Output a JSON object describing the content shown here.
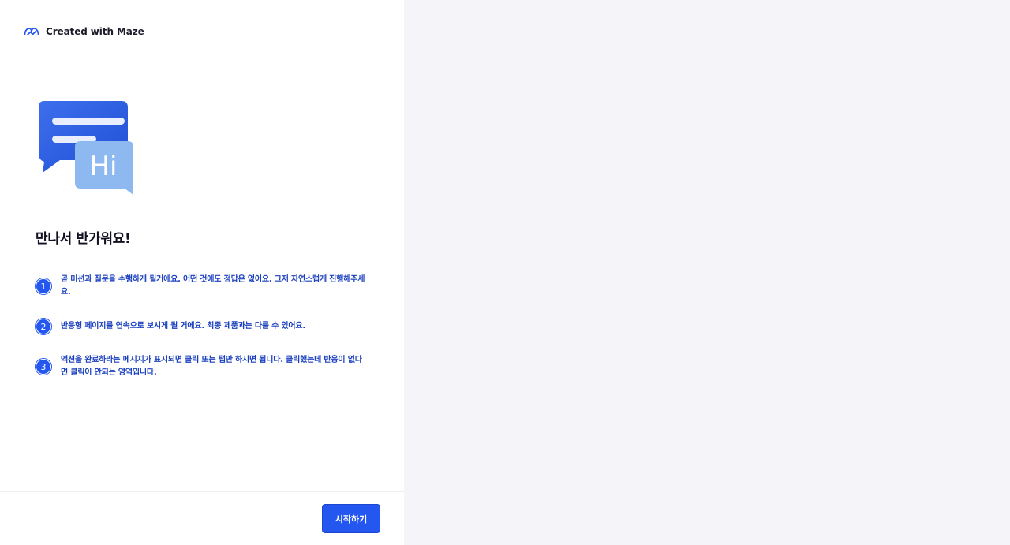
{
  "brand": {
    "label": "Created with Maze",
    "icon": "maze-logo-icon"
  },
  "welcome": {
    "title": "만나서 반가워요!",
    "illustration_text": "Hi"
  },
  "steps": [
    {
      "number": "1",
      "text": "곧 미션과 질문을 수행하게 될거에요. 어떤 것에도 정답은 없어요. 그저 자연스럽게 진행해주세요."
    },
    {
      "number": "2",
      "text": "반응형 페이지를 연속으로 보시게 될 거에요. 최종 제품과는 다를 수 있어요."
    },
    {
      "number": "3",
      "text": "액션을 완료하라는 메시지가 표시되면 클릭 또는 탭만 하시면 됩니다. 클릭했는데 반응이 없다면 클릭이 안되는 영역입니다."
    }
  ],
  "footer": {
    "start_label": "시작하기"
  },
  "colors": {
    "accent": "#2457f0",
    "step_text": "#1a3fbf",
    "background": "#f5f5f9"
  }
}
